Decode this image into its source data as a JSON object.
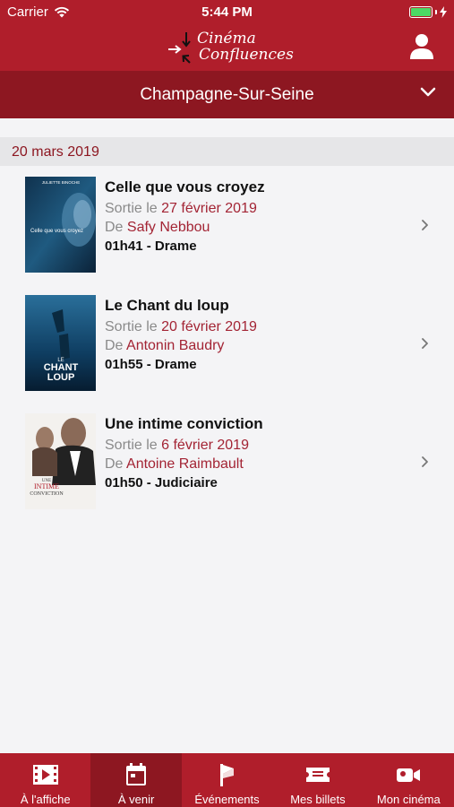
{
  "status_bar": {
    "carrier": "Carrier",
    "time": "5:44 PM"
  },
  "header": {
    "logo_line1": "Cinéma",
    "logo_line2": "Confluences",
    "location": "Champagne-Sur-Seine"
  },
  "section": {
    "date": "20 mars 2019"
  },
  "movies": [
    {
      "title": "Celle que vous croyez",
      "release_prefix": "Sortie le ",
      "release_date": "27 février 2019",
      "director_prefix": "De ",
      "director": "Safy Nebbou",
      "meta": "01h41 - Drame",
      "poster_top": "JULIETTE BINOCHE",
      "poster_title": "Celle que vous croyez"
    },
    {
      "title": "Le Chant du loup",
      "release_prefix": "Sortie le ",
      "release_date": "20 février 2019",
      "director_prefix": "De ",
      "director": "Antonin Baudry",
      "meta": "01h55 - Drame",
      "poster_title1": "LE",
      "poster_title2": "CHANT",
      "poster_title3": "LOUP"
    },
    {
      "title": "Une intime conviction",
      "release_prefix": "Sortie le ",
      "release_date": "6 février 2019",
      "director_prefix": "De ",
      "director": "Antoine Raimbault",
      "meta": "01h50 - Judiciaire",
      "poster_title1": "UNE",
      "poster_title2": "INTIME",
      "poster_title3": "CONVICTION"
    }
  ],
  "tabs": [
    {
      "label": "À l'affiche",
      "icon": "film-icon",
      "active": false
    },
    {
      "label": "À venir",
      "icon": "calendar-icon",
      "active": true
    },
    {
      "label": "Événements",
      "icon": "flag-icon",
      "active": false
    },
    {
      "label": "Mes billets",
      "icon": "ticket-icon",
      "active": false
    },
    {
      "label": "Mon cinéma",
      "icon": "camera-icon",
      "active": false
    }
  ],
  "colors": {
    "brand_red": "#b01e2b",
    "dark_red": "#8d1721",
    "accent_text": "#a32434",
    "battery_green": "#4cd964"
  }
}
